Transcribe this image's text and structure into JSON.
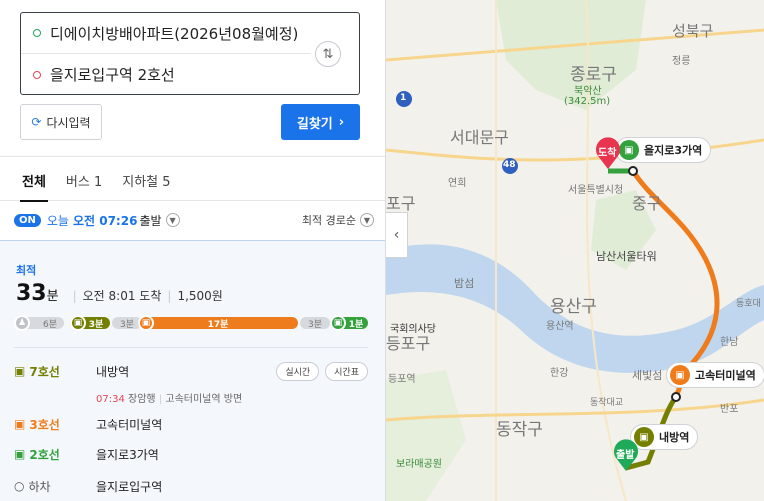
{
  "search": {
    "origin": "디에이치방배아파트(2026년08월예정)",
    "destination": "을지로입구역 2호선",
    "reset_label": "다시입력",
    "find_label": "길찾기",
    "swap_icon": "swap-icon"
  },
  "tabs": [
    {
      "label": "전체",
      "active": true
    },
    {
      "label": "버스 1",
      "active": false
    },
    {
      "label": "지하철 5",
      "active": false
    }
  ],
  "time_bar": {
    "badge": "ON",
    "today": "오늘",
    "time": "오전 07:26",
    "depart": "출발",
    "sort": "최적 경로순"
  },
  "route": {
    "tag": "최적",
    "duration_num": "33",
    "duration_unit": "분",
    "arrive": "오전 8:01 도착",
    "fare": "1,500원",
    "segments": [
      {
        "kind": "walk",
        "label": "6분"
      },
      {
        "kind": "line7",
        "label": "3분"
      },
      {
        "kind": "walk",
        "label": "3분"
      },
      {
        "kind": "line3",
        "label": "17분"
      },
      {
        "kind": "walk",
        "label": "3분"
      },
      {
        "kind": "line2",
        "label": "1분"
      }
    ],
    "steps": [
      {
        "line": "7호선",
        "station": "내방역",
        "btn1": "실시간",
        "btn2": "시간표"
      },
      {
        "line": "3호선",
        "station": "고속터미널역"
      },
      {
        "line": "2호선",
        "station": "을지로3가역"
      },
      {
        "line": "하차",
        "station": "을지로입구역"
      }
    ],
    "sub_time": "07:34",
    "sub_dir": "장암행",
    "sub_next": "고속터미널역 방면"
  },
  "map": {
    "labels": {
      "seongbuk": "성북구",
      "jongno": "종로구",
      "bukaksan": "북악산",
      "bukaksan_h": "(342.5m)",
      "jeongreung": "정릉",
      "seodaemun": "서대문구",
      "yeonhui": "연희",
      "junggu": "중구",
      "cityhall": "서울특별시청",
      "namsan": "남산서울타워",
      "mapo": "포구",
      "bamseom": "밤섬",
      "yongsan": "용산구",
      "yongsanyeok": "용산역",
      "assembly": "국회의사당",
      "deungpo": "등포구",
      "yeouido": "등포역",
      "hangang": "한강",
      "dongjak": "동작구",
      "dongjakdaegyo": "동작대교",
      "boramae": "보라매공원",
      "sebit": "세빛섬",
      "banpo": "반포",
      "hannam": "한남",
      "dongho": "동호대",
      "road48": "48",
      "road1": "1"
    },
    "callouts": {
      "euljiro3": "을지로3가역",
      "express": "고속터미널역",
      "naebang": "내방역"
    },
    "pins": {
      "arrive": "도착",
      "depart": "출발"
    },
    "colors": {
      "line2": "#33a23d",
      "line3": "#ef7c1c",
      "line7": "#747f00",
      "accent": "#1a73e8"
    }
  }
}
